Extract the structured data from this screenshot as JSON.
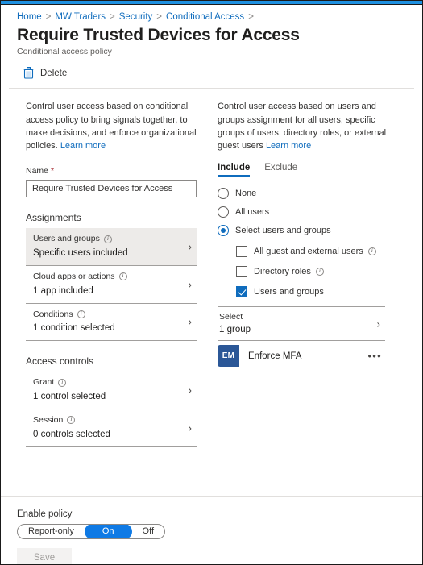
{
  "breadcrumb": {
    "items": [
      "Home",
      "MW Traders",
      "Security",
      "Conditional Access"
    ],
    "separator": ">"
  },
  "header": {
    "title": "Require Trusted Devices for Access",
    "subtitle": "Conditional access policy"
  },
  "commandbar": {
    "delete_label": "Delete",
    "delete_icon": "trash-icon"
  },
  "left": {
    "intro": "Control user access based on conditional access policy to bring signals together, to make decisions, and enforce organizational policies.",
    "learn_more": "Learn more",
    "name_label": "Name",
    "name_required_marker": "*",
    "name_value": "Require Trusted Devices for Access",
    "assignments_heading": "Assignments",
    "assignments": [
      {
        "title": "Users and groups",
        "value": "Specific users included",
        "selected": true
      },
      {
        "title": "Cloud apps or actions",
        "value": "1 app included",
        "selected": false
      },
      {
        "title": "Conditions",
        "value": "1 condition selected",
        "selected": false
      }
    ],
    "access_controls_heading": "Access controls",
    "access_controls": [
      {
        "title": "Grant",
        "value": "1 control selected",
        "selected": false
      },
      {
        "title": "Session",
        "value": "0 controls selected",
        "selected": false
      }
    ],
    "chevron_icon": "chevron-right-icon",
    "info_icon": "info-icon"
  },
  "right": {
    "intro": "Control user access based on users and groups assignment for all users, specific groups of users, directory roles, or external guest users",
    "learn_more": "Learn more",
    "tabs": [
      {
        "label": "Include",
        "active": true
      },
      {
        "label": "Exclude",
        "active": false
      }
    ],
    "radios": [
      {
        "label": "None",
        "checked": false
      },
      {
        "label": "All users",
        "checked": false
      },
      {
        "label": "Select users and groups",
        "checked": true
      }
    ],
    "checkboxes": [
      {
        "label": "All guest and external users",
        "checked": false,
        "info": true
      },
      {
        "label": "Directory roles",
        "checked": false,
        "info": true
      },
      {
        "label": "Users and groups",
        "checked": true,
        "info": false
      }
    ],
    "select_row": {
      "title": "Select",
      "value": "1 group"
    },
    "group": {
      "initials": "EM",
      "name": "Enforce MFA",
      "more_label": "•••"
    }
  },
  "footer": {
    "enable_policy_label": "Enable policy",
    "toggle_options": [
      {
        "label": "Report-only",
        "active": false
      },
      {
        "label": "On",
        "active": true
      },
      {
        "label": "Off",
        "active": false
      }
    ],
    "save_label": "Save"
  },
  "colors": {
    "accent": "#0f6cbd",
    "toggle_on": "#0f7ae5",
    "avatar": "#2b5797",
    "required": "#a4262c",
    "titlebar": "#1e90e0"
  }
}
